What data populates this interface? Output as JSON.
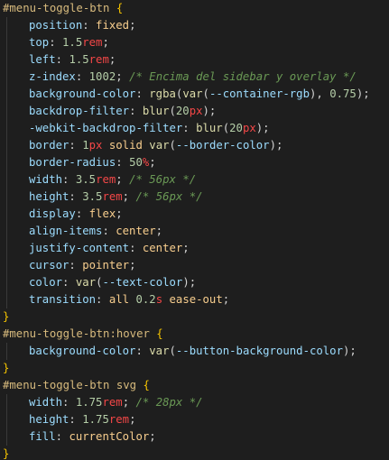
{
  "editor": {
    "language": "css",
    "theme_colors": {
      "background": "#1e1e1e",
      "selector": "#d7ba7d",
      "property": "#9cdcfe",
      "number": "#b5cea8",
      "unit": "#f44747",
      "function": "#dcdcaa",
      "comment": "#6a9955",
      "brace": "#f5c400"
    },
    "lines": [
      {
        "indent": false,
        "tokens": [
          {
            "t": "sel",
            "v": "#menu-toggle-btn"
          },
          {
            "t": "punct",
            "v": " "
          },
          {
            "t": "brace",
            "v": "{"
          }
        ]
      },
      {
        "indent": true,
        "tokens": [
          {
            "t": "prop",
            "v": "position"
          },
          {
            "t": "punct",
            "v": ": "
          },
          {
            "t": "kw",
            "v": "fixed"
          },
          {
            "t": "punct",
            "v": ";"
          }
        ]
      },
      {
        "indent": true,
        "tokens": [
          {
            "t": "prop",
            "v": "top"
          },
          {
            "t": "punct",
            "v": ": "
          },
          {
            "t": "num",
            "v": "1.5"
          },
          {
            "t": "unit",
            "v": "rem"
          },
          {
            "t": "punct",
            "v": ";"
          }
        ]
      },
      {
        "indent": true,
        "tokens": [
          {
            "t": "prop",
            "v": "left"
          },
          {
            "t": "punct",
            "v": ": "
          },
          {
            "t": "num",
            "v": "1.5"
          },
          {
            "t": "unit",
            "v": "rem"
          },
          {
            "t": "punct",
            "v": ";"
          }
        ]
      },
      {
        "indent": true,
        "tokens": [
          {
            "t": "prop",
            "v": "z-index"
          },
          {
            "t": "punct",
            "v": ": "
          },
          {
            "t": "num",
            "v": "1002"
          },
          {
            "t": "punct",
            "v": "; "
          },
          {
            "t": "comment",
            "v": "/* Encima del sidebar y overlay */"
          }
        ]
      },
      {
        "indent": true,
        "tokens": [
          {
            "t": "prop",
            "v": "background-color"
          },
          {
            "t": "punct",
            "v": ": "
          },
          {
            "t": "fn",
            "v": "rgba"
          },
          {
            "t": "punct",
            "v": "("
          },
          {
            "t": "fn",
            "v": "var"
          },
          {
            "t": "punct",
            "v": "("
          },
          {
            "t": "var",
            "v": "--container-rgb"
          },
          {
            "t": "punct",
            "v": "), "
          },
          {
            "t": "num",
            "v": "0.75"
          },
          {
            "t": "punct",
            "v": ");"
          }
        ]
      },
      {
        "indent": true,
        "tokens": [
          {
            "t": "prop",
            "v": "backdrop-filter"
          },
          {
            "t": "punct",
            "v": ": "
          },
          {
            "t": "fn",
            "v": "blur"
          },
          {
            "t": "punct",
            "v": "("
          },
          {
            "t": "num",
            "v": "20"
          },
          {
            "t": "unit",
            "v": "px"
          },
          {
            "t": "punct",
            "v": ");"
          }
        ]
      },
      {
        "indent": true,
        "tokens": [
          {
            "t": "prop",
            "v": "-webkit-backdrop-filter"
          },
          {
            "t": "punct",
            "v": ": "
          },
          {
            "t": "fn",
            "v": "blur"
          },
          {
            "t": "punct",
            "v": "("
          },
          {
            "t": "num",
            "v": "20"
          },
          {
            "t": "unit",
            "v": "px"
          },
          {
            "t": "punct",
            "v": ");"
          }
        ]
      },
      {
        "indent": true,
        "tokens": [
          {
            "t": "prop",
            "v": "border"
          },
          {
            "t": "punct",
            "v": ": "
          },
          {
            "t": "num",
            "v": "1"
          },
          {
            "t": "unit",
            "v": "px"
          },
          {
            "t": "punct",
            "v": " "
          },
          {
            "t": "kw",
            "v": "solid"
          },
          {
            "t": "punct",
            "v": " "
          },
          {
            "t": "fn",
            "v": "var"
          },
          {
            "t": "punct",
            "v": "("
          },
          {
            "t": "var",
            "v": "--border-color"
          },
          {
            "t": "punct",
            "v": ");"
          }
        ]
      },
      {
        "indent": true,
        "tokens": [
          {
            "t": "prop",
            "v": "border-radius"
          },
          {
            "t": "punct",
            "v": ": "
          },
          {
            "t": "num",
            "v": "50"
          },
          {
            "t": "unit",
            "v": "%"
          },
          {
            "t": "punct",
            "v": ";"
          }
        ]
      },
      {
        "indent": true,
        "tokens": [
          {
            "t": "prop",
            "v": "width"
          },
          {
            "t": "punct",
            "v": ": "
          },
          {
            "t": "num",
            "v": "3.5"
          },
          {
            "t": "unit",
            "v": "rem"
          },
          {
            "t": "punct",
            "v": "; "
          },
          {
            "t": "comment",
            "v": "/* 56px */"
          }
        ]
      },
      {
        "indent": true,
        "tokens": [
          {
            "t": "prop",
            "v": "height"
          },
          {
            "t": "punct",
            "v": ": "
          },
          {
            "t": "num",
            "v": "3.5"
          },
          {
            "t": "unit",
            "v": "rem"
          },
          {
            "t": "punct",
            "v": "; "
          },
          {
            "t": "comment",
            "v": "/* 56px */"
          }
        ]
      },
      {
        "indent": true,
        "tokens": [
          {
            "t": "prop",
            "v": "display"
          },
          {
            "t": "punct",
            "v": ": "
          },
          {
            "t": "kw",
            "v": "flex"
          },
          {
            "t": "punct",
            "v": ";"
          }
        ]
      },
      {
        "indent": true,
        "tokens": [
          {
            "t": "prop",
            "v": "align-items"
          },
          {
            "t": "punct",
            "v": ": "
          },
          {
            "t": "kw",
            "v": "center"
          },
          {
            "t": "punct",
            "v": ";"
          }
        ]
      },
      {
        "indent": true,
        "tokens": [
          {
            "t": "prop",
            "v": "justify-content"
          },
          {
            "t": "punct",
            "v": ": "
          },
          {
            "t": "kw",
            "v": "center"
          },
          {
            "t": "punct",
            "v": ";"
          }
        ]
      },
      {
        "indent": true,
        "tokens": [
          {
            "t": "prop",
            "v": "cursor"
          },
          {
            "t": "punct",
            "v": ": "
          },
          {
            "t": "kw",
            "v": "pointer"
          },
          {
            "t": "punct",
            "v": ";"
          }
        ]
      },
      {
        "indent": true,
        "tokens": [
          {
            "t": "prop",
            "v": "color"
          },
          {
            "t": "punct",
            "v": ": "
          },
          {
            "t": "fn",
            "v": "var"
          },
          {
            "t": "punct",
            "v": "("
          },
          {
            "t": "var",
            "v": "--text-color"
          },
          {
            "t": "punct",
            "v": ");"
          }
        ]
      },
      {
        "indent": true,
        "tokens": [
          {
            "t": "prop",
            "v": "transition"
          },
          {
            "t": "punct",
            "v": ": "
          },
          {
            "t": "kw",
            "v": "all"
          },
          {
            "t": "punct",
            "v": " "
          },
          {
            "t": "num",
            "v": "0.2"
          },
          {
            "t": "unit",
            "v": "s"
          },
          {
            "t": "punct",
            "v": " "
          },
          {
            "t": "kw",
            "v": "ease-out"
          },
          {
            "t": "punct",
            "v": ";"
          }
        ]
      },
      {
        "indent": false,
        "tokens": [
          {
            "t": "brace",
            "v": "}"
          }
        ]
      },
      {
        "indent": false,
        "tokens": [
          {
            "t": "sel",
            "v": "#menu-toggle-btn:hover"
          },
          {
            "t": "punct",
            "v": " "
          },
          {
            "t": "brace",
            "v": "{"
          }
        ]
      },
      {
        "indent": true,
        "tokens": [
          {
            "t": "prop",
            "v": "background-color"
          },
          {
            "t": "punct",
            "v": ": "
          },
          {
            "t": "fn",
            "v": "var"
          },
          {
            "t": "punct",
            "v": "("
          },
          {
            "t": "var",
            "v": "--button-background-color"
          },
          {
            "t": "punct",
            "v": ");"
          }
        ]
      },
      {
        "indent": false,
        "tokens": [
          {
            "t": "brace",
            "v": "}"
          }
        ]
      },
      {
        "indent": false,
        "tokens": [
          {
            "t": "sel",
            "v": "#menu-toggle-btn svg"
          },
          {
            "t": "punct",
            "v": " "
          },
          {
            "t": "brace",
            "v": "{"
          }
        ]
      },
      {
        "indent": true,
        "tokens": [
          {
            "t": "prop",
            "v": "width"
          },
          {
            "t": "punct",
            "v": ": "
          },
          {
            "t": "num",
            "v": "1.75"
          },
          {
            "t": "unit",
            "v": "rem"
          },
          {
            "t": "punct",
            "v": "; "
          },
          {
            "t": "comment",
            "v": "/* 28px */"
          }
        ]
      },
      {
        "indent": true,
        "tokens": [
          {
            "t": "prop",
            "v": "height"
          },
          {
            "t": "punct",
            "v": ": "
          },
          {
            "t": "num",
            "v": "1.75"
          },
          {
            "t": "unit",
            "v": "rem"
          },
          {
            "t": "punct",
            "v": ";"
          }
        ]
      },
      {
        "indent": true,
        "tokens": [
          {
            "t": "prop",
            "v": "fill"
          },
          {
            "t": "punct",
            "v": ": "
          },
          {
            "t": "kw",
            "v": "currentColor"
          },
          {
            "t": "punct",
            "v": ";"
          }
        ]
      },
      {
        "indent": false,
        "tokens": [
          {
            "t": "brace",
            "v": "}"
          }
        ]
      }
    ]
  }
}
